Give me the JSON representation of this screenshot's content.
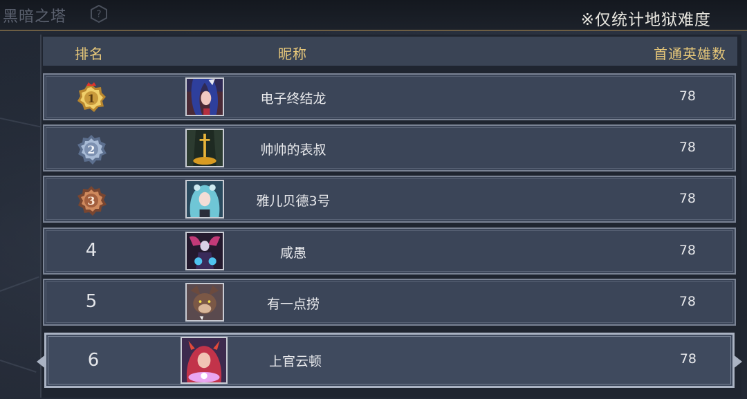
{
  "window_title": "黑暗之塔",
  "notice": "※仅统计地狱难度",
  "columns": {
    "rank": "排名",
    "nickname": "昵称",
    "first_clear_heroes": "首通英雄数"
  },
  "rows": [
    {
      "rank": "1",
      "rank_display": "medal-gold",
      "nickname": "电子终结龙",
      "count": "78",
      "avatar": "blue-haired-girl-avatar"
    },
    {
      "rank": "2",
      "rank_display": "medal-silver",
      "nickname": "帅帅的表叔",
      "count": "78",
      "avatar": "golden-sword-avatar"
    },
    {
      "rank": "3",
      "rank_display": "medal-bronze",
      "nickname": "雅儿贝德3号",
      "count": "78",
      "avatar": "teal-haired-girl-avatar"
    },
    {
      "rank": "4",
      "rank_display": "number",
      "nickname": "咸愚",
      "count": "78",
      "avatar": "dark-mage-avatar"
    },
    {
      "rank": "5",
      "rank_display": "number",
      "nickname": "有一点捞",
      "count": "78",
      "avatar": "werewolf-avatar"
    },
    {
      "rank": "6",
      "rank_display": "number",
      "nickname": "上官云顿",
      "count": "78",
      "avatar": "demon-girl-avatar",
      "selected": true
    }
  ],
  "colors": {
    "header_text": "#e9c97a",
    "row_bg": "#3b4558",
    "gold": "#e8c25a",
    "silver": "#9fb3cf",
    "bronze": "#c07a52"
  }
}
